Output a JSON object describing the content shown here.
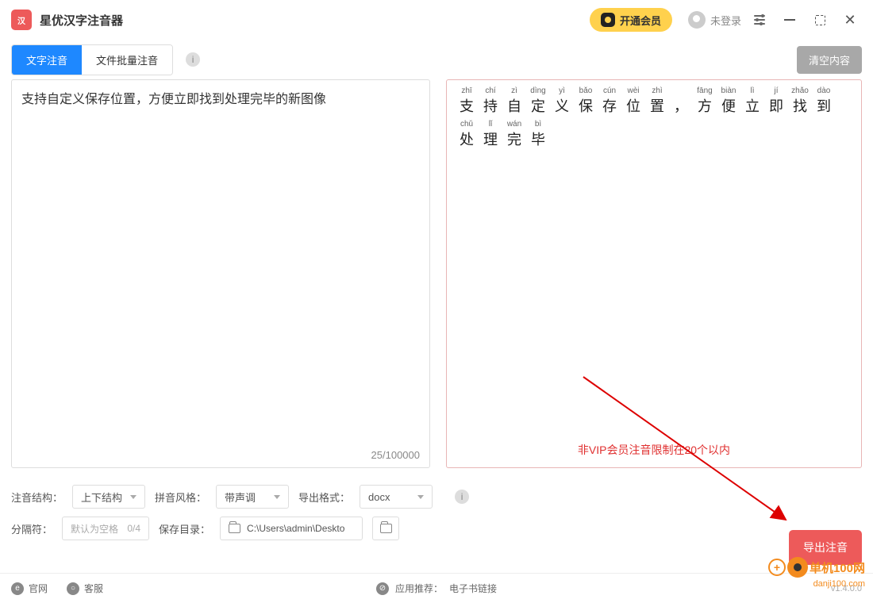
{
  "app": {
    "title": "星优汉字注音器"
  },
  "titlebar": {
    "vip_button": "开通会员",
    "login_status": "未登录"
  },
  "tabs": {
    "text_mode": "文字注音",
    "file_mode": "文件批量注音"
  },
  "toolbar": {
    "clear_button": "清空内容"
  },
  "input": {
    "text": "支持自定义保存位置，方便立即找到处理完毕的新图像",
    "counter": "25/100000"
  },
  "preview": {
    "chars": [
      {
        "py": "zhī",
        "hz": "支"
      },
      {
        "py": "chí",
        "hz": "持"
      },
      {
        "py": "zì",
        "hz": "自"
      },
      {
        "py": "dìng",
        "hz": "定"
      },
      {
        "py": "yì",
        "hz": "义"
      },
      {
        "py": "bǎo",
        "hz": "保"
      },
      {
        "py": "cún",
        "hz": "存"
      },
      {
        "py": "wèi",
        "hz": "位"
      },
      {
        "py": "zhì",
        "hz": "置"
      },
      {
        "py": "",
        "hz": "，",
        "punct": true
      },
      {
        "py": "fāng",
        "hz": "方"
      },
      {
        "py": "biàn",
        "hz": "便"
      },
      {
        "py": "lì",
        "hz": "立"
      },
      {
        "py": "jí",
        "hz": "即"
      },
      {
        "py": "zhǎo",
        "hz": "找"
      },
      {
        "py": "dào",
        "hz": "到"
      },
      {
        "py": "chǔ",
        "hz": "处"
      },
      {
        "py": "lǐ",
        "hz": "理"
      },
      {
        "py": "wán",
        "hz": "完"
      },
      {
        "py": "bì",
        "hz": "毕"
      }
    ],
    "vip_limit": "非VIP会员注音限制在20个以内"
  },
  "options": {
    "structure_label": "注音结构：",
    "structure_value": "上下结构",
    "style_label": "拼音风格：",
    "style_value": "带声调",
    "format_label": "导出格式：",
    "format_value": "docx",
    "separator_label": "分隔符：",
    "separator_placeholder": "默认为空格",
    "separator_count": "0/4",
    "savedir_label": "保存目录：",
    "savedir_value": "C:\\Users\\admin\\Deskto"
  },
  "export_button": "导出注音",
  "footer": {
    "official_site": "官网",
    "support": "客服",
    "recommend_label": "应用推荐：",
    "recommend_link": "电子书链接",
    "version": "v1.4.0.0"
  },
  "watermark": {
    "cn": "单机100网",
    "en": "danji100.com"
  }
}
